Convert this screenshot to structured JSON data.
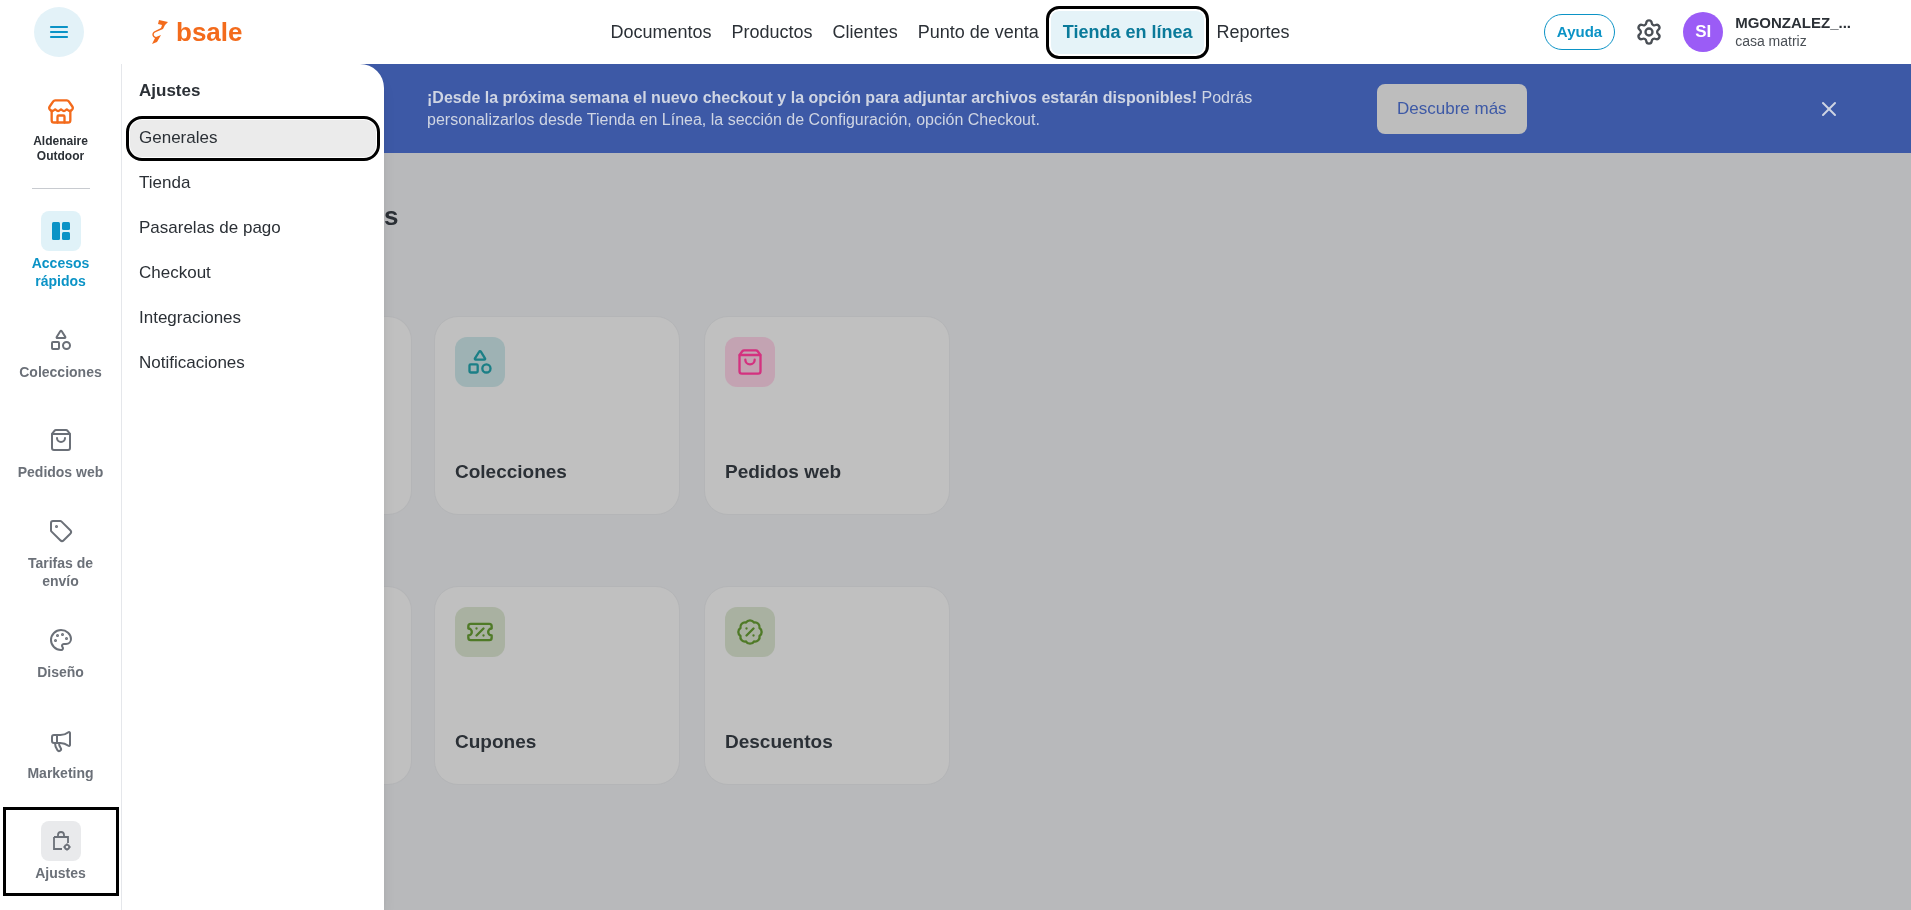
{
  "topbar": {
    "brand": "bsale",
    "nav": [
      {
        "label": "Documentos",
        "selected": false
      },
      {
        "label": "Productos",
        "selected": false
      },
      {
        "label": "Clientes",
        "selected": false
      },
      {
        "label": "Punto de venta",
        "selected": false
      },
      {
        "label": "Tienda en línea",
        "selected": true
      },
      {
        "label": "Reportes",
        "selected": false
      }
    ],
    "help": "Ayuda",
    "user": {
      "initials": "SI",
      "name": "MGONZALEZ_...",
      "branch": "casa matriz"
    }
  },
  "sidebar": {
    "store": "Aldenaire Outdoor",
    "items": [
      {
        "label": "Accesos rápidos",
        "active": true,
        "selected": false
      },
      {
        "label": "Colecciones",
        "active": false,
        "selected": false
      },
      {
        "label": "Pedidos web",
        "active": false,
        "selected": false
      },
      {
        "label": "Tarifas de envío",
        "active": false,
        "selected": false
      },
      {
        "label": "Diseño",
        "active": false,
        "selected": false
      },
      {
        "label": "Marketing",
        "active": false,
        "selected": false
      },
      {
        "label": "Ajustes",
        "active": false,
        "selected": true
      }
    ]
  },
  "flyout": {
    "title": "Ajustes",
    "items": [
      {
        "label": "Generales",
        "selected": true
      },
      {
        "label": "Tienda",
        "selected": false
      },
      {
        "label": "Pasarelas de pago",
        "selected": false
      },
      {
        "label": "Checkout",
        "selected": false
      },
      {
        "label": "Integraciones",
        "selected": false
      },
      {
        "label": "Notificaciones",
        "selected": false
      }
    ]
  },
  "banner": {
    "message": "**¡Desde la próxima semana el nuevo checkout y la opción para adjuntar archivos estarán disponibles!** Podrás personalizarlos desde Tienda en Línea, la sección de Configuración, opción Checkout.",
    "button": "Descubre más"
  },
  "main": {
    "heading": "s",
    "card_rows": [
      {
        "cards": [
          {
            "title": "Colecciones",
            "color": "#1b7f86"
          },
          {
            "title": "Pedidos web",
            "color": "#d4317f"
          }
        ]
      },
      {
        "cards": [
          {
            "title": "Cupones",
            "color": "#4f7a27"
          },
          {
            "title": "Descuentos",
            "color": "#4f7a27"
          }
        ]
      }
    ]
  }
}
